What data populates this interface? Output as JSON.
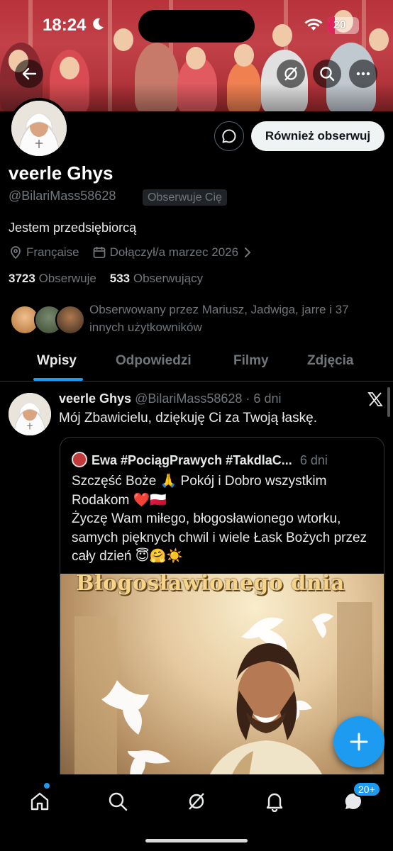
{
  "status_bar": {
    "time": "18:24",
    "battery": "20"
  },
  "profile": {
    "name": "veerle Ghys",
    "handle": "@BilariMass58628",
    "follows_you_label": "Obserwuje Cię",
    "follow_back_label": "Również obserwuj",
    "bio": "Jestem przedsiębiorcą",
    "location": "Française",
    "joined": "Dołączył/a marzec 2026",
    "following_count": "3723",
    "following_label": "Obserwuje",
    "followers_count": "533",
    "followers_label": "Obserwujący",
    "followed_by_text": "Obserwowany przez Mariusz, Jadwiga, jarre i 37 innych użytkowników"
  },
  "tabs": [
    {
      "label": "Wpisy",
      "active": true
    },
    {
      "label": "Odpowiedzi",
      "active": false
    },
    {
      "label": "Filmy",
      "active": false
    },
    {
      "label": "Zdjęcia",
      "active": false
    }
  ],
  "post": {
    "author": "veerle Ghys",
    "handle_time": "@BilariMass58628 · 6 dni",
    "text": "Mój Zbawicielu, dziękuję Ci za Twoją łaskę.",
    "quote": {
      "author": "Ewa #PociągPrawych #TakdlaC...",
      "time": "6 dni",
      "text_line1": "Szczęść Boże 🙏 Pokój i Dobro wszystkim Rodakom ❤️🇵🇱",
      "text_line2": "Życzę Wam miłego, błogosławionego wtorku, samych pięknych chwil i wiele Łask Bożych przez cały dzień 😇🤗☀️",
      "image_caption": "Błogosławionego dnia"
    }
  },
  "bottom_nav": {
    "messages_badge": "20+"
  },
  "colors": {
    "accent": "#1d9bf0",
    "background": "#000000",
    "muted": "#71767b"
  },
  "icons": [
    "back-arrow-icon",
    "grok-icon",
    "search-icon",
    "more-icon",
    "message-icon",
    "location-icon",
    "calendar-icon",
    "chevron-right-icon",
    "x-logo-icon",
    "compose-plus-icon",
    "home-icon",
    "search-icon",
    "grok-icon",
    "bell-icon",
    "messages-icon"
  ]
}
